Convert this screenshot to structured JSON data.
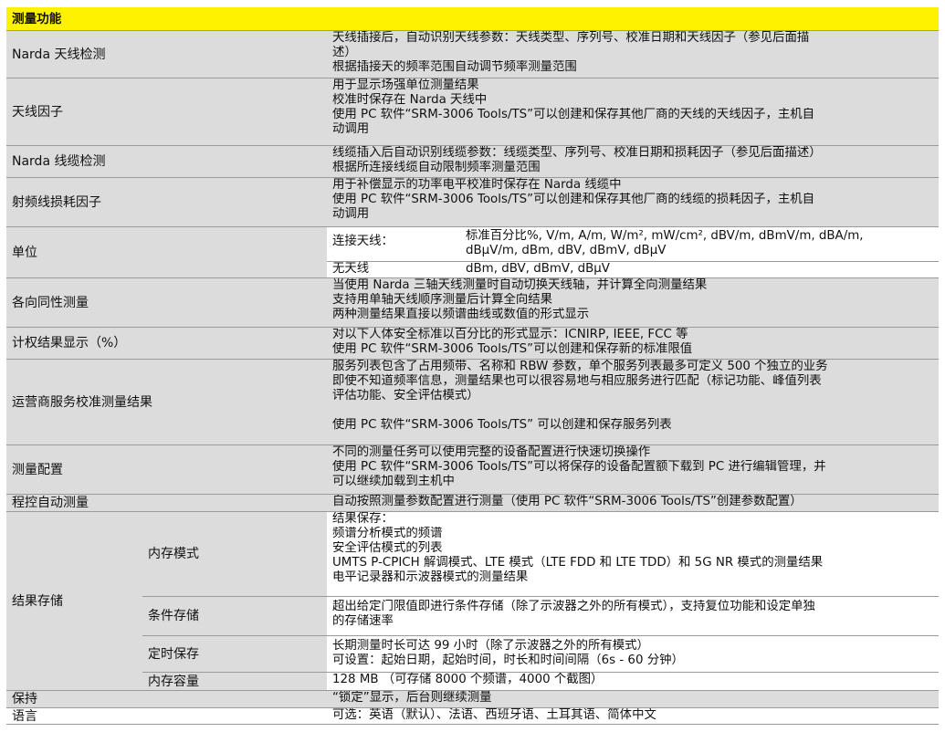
{
  "header": {
    "title": "测量功能"
  },
  "rows": [
    {
      "label": "Narda 天线检测",
      "lines": [
        "天线插接后，自动识别天线参数：天线类型、序列号、校准日期和天线因子（参见后面描",
        "述）",
        "根据插接天的频率范围自动调节频率测量范围"
      ]
    },
    {
      "label": "天线因子",
      "lines": [
        "用于显示场强单位测量结果",
        "校准时保存在 Narda 天线中",
        "使用 PC 软件“SRM-3006 Tools/TS”可以创建和保存其他厂商的天线的天线因子，主机自",
        "动调用"
      ]
    },
    {
      "label": "Narda 线缆检测",
      "lines": [
        "线缆插入后自动识别线缆参数：线缆类型、序列号、校准日期和损耗因子（参见后面描述）",
        "根据所连接线缆自动限制频率测量范围"
      ]
    },
    {
      "label": "射频线损耗因子",
      "lines": [
        "用于补偿显示的功率电平校准时保存在 Narda 线缆中",
        "使用 PC 软件“SRM-3006 Tools/TS”可以创建和保存其他厂商的线缆的损耗因子，主机自",
        "动调用"
      ]
    },
    {
      "label": "单位",
      "connected_label": "连接天线：",
      "connected_values": [
        "标准百分比%, V/m, A/m, W/m², mW/cm², dBV/m, dBmV/m, dBA/m,",
        "dBμV/m, dBm, dBV, dBmV, dBμV"
      ],
      "none_label": "无天线",
      "none_values": "dBm, dBV, dBmV, dBμV"
    },
    {
      "label": "各向同性测量",
      "lines": [
        "当使用 Narda 三轴天线测量时自动切换天线轴，并计算全向测量结果",
        "支持用单轴天线顺序测量后计算全向结果",
        "两种测量结果直接以频谱曲线或数值的形式显示"
      ]
    },
    {
      "label": "计权结果显示（%）",
      "lines": [
        "对以下人体安全标准以百分比的形式显示：ICNIRP, IEEE, FCC 等",
        "使用 PC 软件“SRM-3006 Tools/TS”可以创建和保存新的标准限值"
      ]
    },
    {
      "label": "运营商服务校准测量结果",
      "lines": [
        "服务列表包含了占用频带、名称和 RBW 参数，单个服务列表最多可定义 500 个独立的业务",
        "即使不知道频率信息，测量结果也可以很容易地与相应服务进行匹配（标记功能、峰值列表",
        "评估功能、安全评估模式）",
        "",
        "使用 PC 软件“SRM-3006 Tools/TS” 可以创建和保存服务列表"
      ]
    },
    {
      "label": "测量配置",
      "lines": [
        "不同的测量任务可以使用完整的设备配置进行快速切换操作",
        "使用 PC 软件“SRM-3006 Tools/TS”可以将保存的设备配置额下载到 PC 进行编辑管理，并",
        "可以继续加载到主机中"
      ]
    },
    {
      "label": "程控自动测量",
      "lines": [
        "自动按照测量参数配置进行测量（使用 PC 软件“SRM-3006 Tools/TS”创建参数配置）"
      ]
    },
    {
      "label": "结果存储",
      "subs": [
        {
          "label": "内存模式",
          "lines": [
            "结果保存：",
            "频谱分析模式的频谱",
            "安全评估模式的列表",
            "UMTS P-CPICH 解调模式、LTE 模式（LTE FDD 和 LTE TDD）和 5G NR 模式的测量结果",
            "电平记录器和示波器模式的测量结果"
          ]
        },
        {
          "label": "条件存储",
          "lines": [
            "超出给定门限值即进行条件存储（除了示波器之外的所有模式），支持复位功能和设定单独",
            "的存储速率"
          ]
        },
        {
          "label": "定时保存",
          "lines": [
            "长期测量时长可达 99 小时（除了示波器之外的所有模式）",
            "可设置：起始日期，起始时间，时长和时间间隔（6s - 60 分钟）"
          ]
        },
        {
          "label": "内存容量",
          "lines": [
            "128 MB （可存储 8000 个频谱，4000 个截图）"
          ]
        }
      ]
    },
    {
      "label": "保持",
      "lines": [
        "“锁定”显示，后台则继续测量"
      ]
    },
    {
      "label": "语言",
      "lines": [
        "可选：英语（默认）、法语、西班牙语、土耳其语、简体中文"
      ]
    }
  ]
}
